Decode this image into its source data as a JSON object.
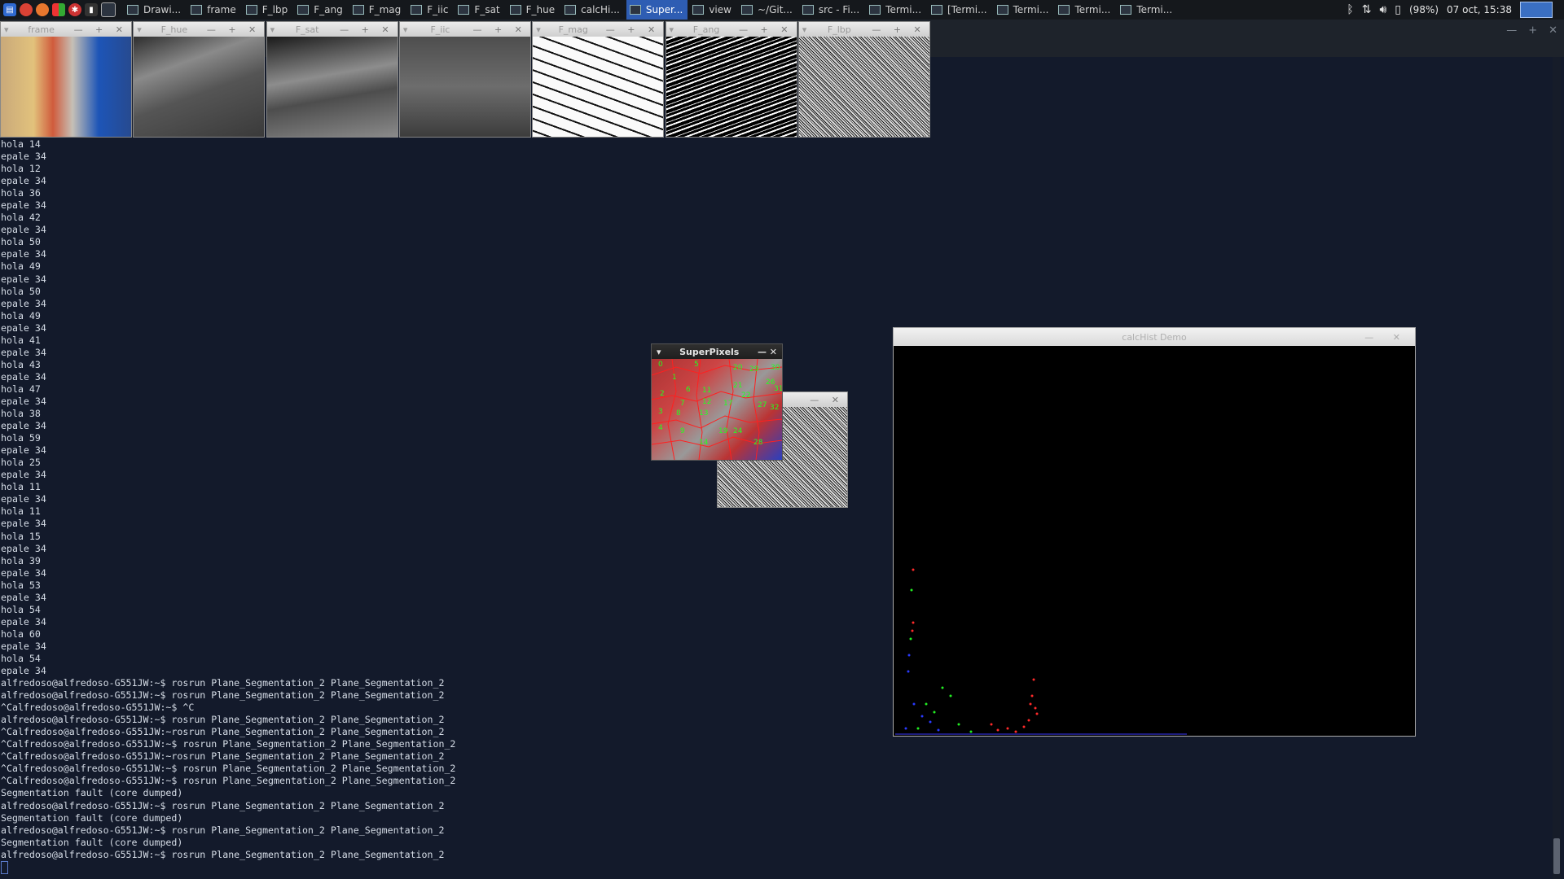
{
  "panel": {
    "tasks": [
      {
        "label": "Drawi...",
        "active": false
      },
      {
        "label": "frame",
        "active": false
      },
      {
        "label": "F_lbp",
        "active": false
      },
      {
        "label": "F_ang",
        "active": false
      },
      {
        "label": "F_mag",
        "active": false
      },
      {
        "label": "F_iic",
        "active": false
      },
      {
        "label": "F_sat",
        "active": false
      },
      {
        "label": "F_hue",
        "active": false
      },
      {
        "label": "calcHi...",
        "active": false
      },
      {
        "label": "Super...",
        "active": true
      },
      {
        "label": "view",
        "active": false
      },
      {
        "label": "~/Git...",
        "active": false
      },
      {
        "label": "src - Fi...",
        "active": false
      },
      {
        "label": "Termi...",
        "active": false
      },
      {
        "label": "[Termi...",
        "active": false
      },
      {
        "label": "Termi...",
        "active": false
      },
      {
        "label": "Termi...",
        "active": false
      },
      {
        "label": "Termi...",
        "active": false
      }
    ],
    "battery": "(98%)",
    "clock": "07 oct, 15:38",
    "tray_icons": [
      "bluetooth-icon",
      "network-icon",
      "volume-icon",
      "battery-icon"
    ]
  },
  "cv_windows": [
    {
      "title": "frame"
    },
    {
      "title": "F_hue"
    },
    {
      "title": "F_sat"
    },
    {
      "title": "F_iic"
    },
    {
      "title": "F_mag"
    },
    {
      "title": "F_ang"
    },
    {
      "title": "F_lbp"
    }
  ],
  "superpixels": {
    "title": "SuperPixels",
    "labels": [
      "0",
      "5",
      "20",
      "29",
      "30",
      "1",
      "21",
      "26",
      "31",
      "2",
      "6",
      "11",
      "22",
      "7",
      "12",
      "17",
      "27",
      "3",
      "8",
      "13",
      "32",
      "4",
      "9",
      "14",
      "19",
      "24",
      "28"
    ]
  },
  "histogram": {
    "title": "calcHist Demo"
  },
  "terminal": {
    "lines": [
      "hola 14",
      "epale 34",
      "hola 12",
      "epale 34",
      "hola 36",
      "epale 34",
      "hola 42",
      "epale 34",
      "hola 50",
      "epale 34",
      "hola 49",
      "epale 34",
      "hola 50",
      "epale 34",
      "hola 49",
      "epale 34",
      "hola 41",
      "epale 34",
      "hola 43",
      "epale 34",
      "hola 47",
      "epale 34",
      "hola 38",
      "epale 34",
      "hola 59",
      "epale 34",
      "hola 25",
      "epale 34",
      "hola 11",
      "epale 34",
      "hola 11",
      "epale 34",
      "hola 15",
      "epale 34",
      "hola 39",
      "epale 34",
      "hola 53",
      "epale 34",
      "hola 54",
      "epale 34",
      "hola 60",
      "epale 34",
      "hola 54",
      "epale 34",
      "alfredoso@alfredoso-G551JW:~$ rosrun Plane_Segmentation_2 Plane_Segmentation_2",
      "alfredoso@alfredoso-G551JW:~$ rosrun Plane_Segmentation_2 Plane_Segmentation_2",
      "^Calfredoso@alfredoso-G551JW:~$ ^C",
      "alfredoso@alfredoso-G551JW:~$ rosrun Plane_Segmentation_2 Plane_Segmentation_2",
      "^Calfredoso@alfredoso-G551JW:~rosrun Plane_Segmentation_2 Plane_Segmentation_2",
      "^Calfredoso@alfredoso-G551JW:~$ rosrun Plane_Segmentation_2 Plane_Segmentation_2",
      "^Calfredoso@alfredoso-G551JW:~rosrun Plane_Segmentation_2 Plane_Segmentation_2",
      "^Calfredoso@alfredoso-G551JW:~$ rosrun Plane_Segmentation_2 Plane_Segmentation_2",
      "^Calfredoso@alfredoso-G551JW:~$ rosrun Plane_Segmentation_2 Plane_Segmentation_2",
      "Segmentation fault (core dumped)",
      "alfredoso@alfredoso-G551JW:~$ rosrun Plane_Segmentation_2 Plane_Segmentation_2",
      "Segmentation fault (core dumped)",
      "alfredoso@alfredoso-G551JW:~$ rosrun Plane_Segmentation_2 Plane_Segmentation_2",
      "Segmentation fault (core dumped)",
      "alfredoso@alfredoso-G551JW:~$ rosrun Plane_Segmentation_2 Plane_Segmentation_2"
    ]
  }
}
